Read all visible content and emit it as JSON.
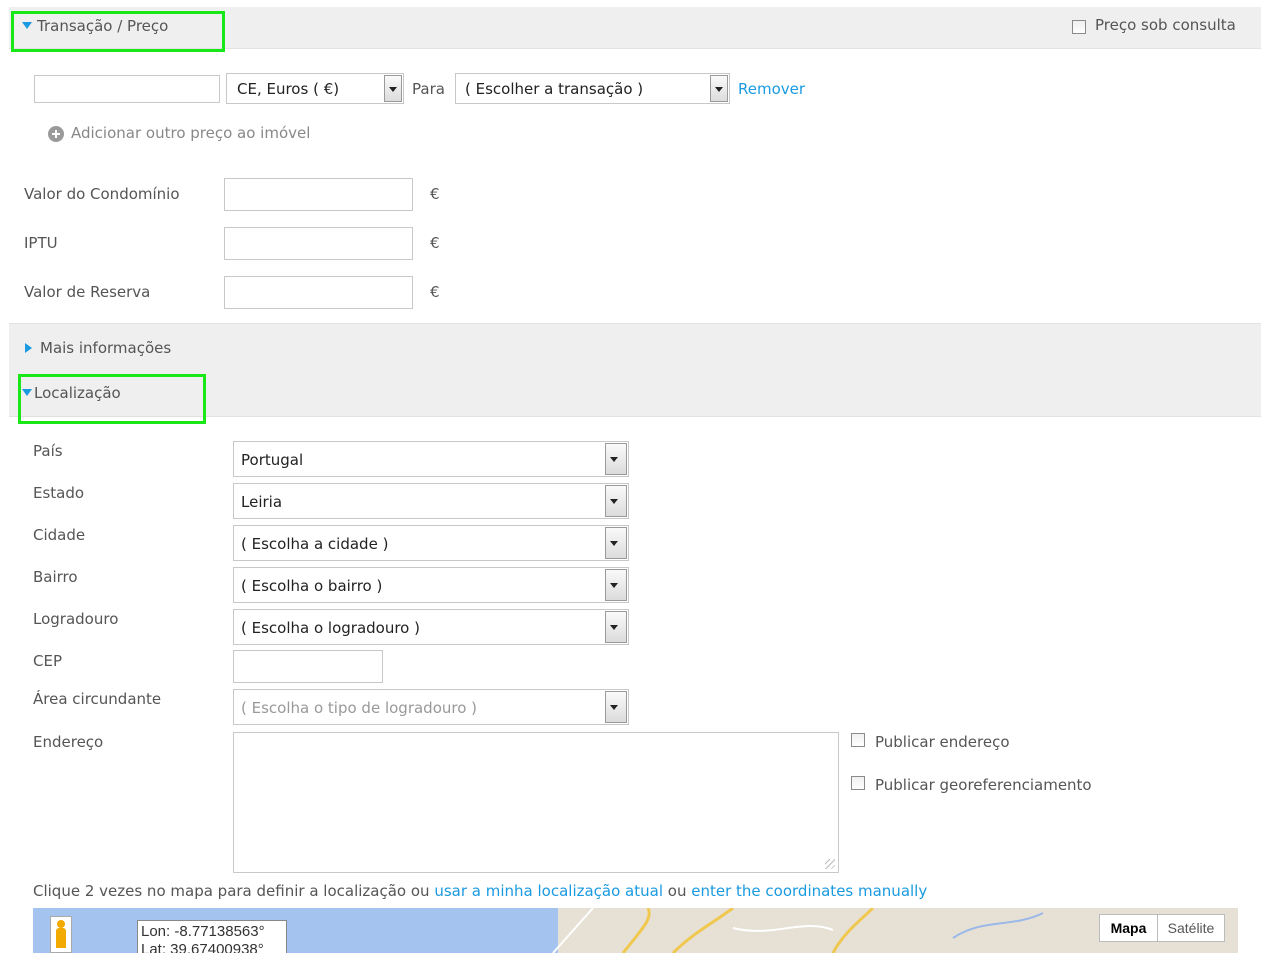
{
  "transaction_section": {
    "title": "Transação / Preço",
    "price_on_request_label": "Preço sob consulta",
    "currency_value": "CE, Euros ( €)",
    "para_label": "Para",
    "transaction_value": "( Escolher a transação )",
    "remove_label": "Remover",
    "add_price_label": "Adicionar outro preço ao imóvel",
    "fields": [
      {
        "label": "Valor do Condomínio",
        "unit": "€"
      },
      {
        "label": "IPTU",
        "unit": "€"
      },
      {
        "label": "Valor de Reserva",
        "unit": "€"
      }
    ]
  },
  "more_info_section": {
    "title": "Mais informações"
  },
  "location_section": {
    "title": "Localização",
    "fields": {
      "country": {
        "label": "País",
        "value": "Portugal"
      },
      "state": {
        "label": "Estado",
        "value": "Leiria"
      },
      "city": {
        "label": "Cidade",
        "value": "( Escolha a cidade )"
      },
      "neighborhood": {
        "label": "Bairro",
        "value": "( Escolha o bairro )"
      },
      "street": {
        "label": "Logradouro",
        "value": "( Escolha o logradouro )"
      },
      "zip": {
        "label": "CEP",
        "value": ""
      },
      "surrounding_area": {
        "label": "Área circundante",
        "value": "( Escolha o tipo de logradouro )"
      },
      "address": {
        "label": "Endereço",
        "value": ""
      }
    },
    "publish_address_label": "Publicar endereço",
    "publish_geo_label": "Publicar georeferenciamento",
    "map_hint_text": "Clique 2 vezes no mapa para definir a localização ou",
    "use_location_link": "usar a minha localização atual",
    "or_text": "ou",
    "manual_coords_link": "enter the coordinates manually"
  },
  "map": {
    "lon_text": "Lon: -8.77138563°",
    "lat_text": "Lat: 39.67400938°",
    "map_button": "Mapa",
    "satellite_button": "Satélite"
  }
}
